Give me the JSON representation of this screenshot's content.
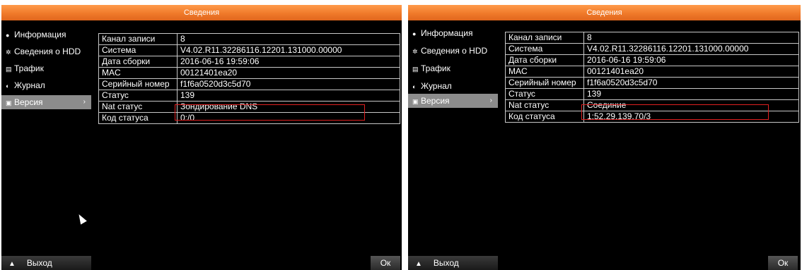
{
  "screens": [
    {
      "title": "Сведения",
      "sidebar": [
        {
          "icon": "info-icon",
          "label": "Информация"
        },
        {
          "icon": "hdd-icon",
          "label": "Сведения о HDD"
        },
        {
          "icon": "traffic-icon",
          "label": "Трафик"
        },
        {
          "icon": "log-icon",
          "label": "Журнал"
        },
        {
          "icon": "version-icon",
          "label": "Версия",
          "active": true
        }
      ],
      "rows": [
        {
          "key": "Канал записи",
          "value": "8"
        },
        {
          "key": "Система",
          "value": "V4.02.R11.32286116.12201.131000.00000"
        },
        {
          "key": "Дата сборки",
          "value": "2016-06-16 19:59:06"
        },
        {
          "key": "MAC",
          "value": "00121401ea20"
        },
        {
          "key": "Серийный номер",
          "value": "f1f6a0520d3c5d70"
        },
        {
          "key": "Статус",
          "value": "139"
        },
        {
          "key": "Nat статус",
          "value": "Зондирование DNS"
        },
        {
          "key": "Код статуса",
          "value": "0:/0"
        }
      ],
      "exit_label": "Выход",
      "ok_label": "Ок"
    },
    {
      "title": "Сведения",
      "sidebar": [
        {
          "icon": "info-icon",
          "label": "Информация"
        },
        {
          "icon": "hdd-icon",
          "label": "Сведения о HDD"
        },
        {
          "icon": "traffic-icon",
          "label": "Трафик"
        },
        {
          "icon": "log-icon",
          "label": "Журнал"
        },
        {
          "icon": "version-icon",
          "label": "Версия",
          "active": true
        }
      ],
      "rows": [
        {
          "key": "Канал записи",
          "value": "8"
        },
        {
          "key": "Система",
          "value": "V4.02.R11.32286116.12201.131000.00000"
        },
        {
          "key": "Дата сборки",
          "value": "2016-06-16 19:59:06"
        },
        {
          "key": "MAC",
          "value": "00121401ea20"
        },
        {
          "key": "Серийный номер",
          "value": "f1f6a0520d3c5d70"
        },
        {
          "key": "Статус",
          "value": "139"
        },
        {
          "key": "Nat статус",
          "value": "Соединие"
        },
        {
          "key": "Код статуса",
          "value": "1:52.29.139.70/3"
        }
      ],
      "exit_label": "Выход",
      "ok_label": "Ок"
    }
  ],
  "colors": {
    "titlebar": "#f07a2a",
    "highlight": "#e02020",
    "active_item": "#8c8c8c"
  }
}
